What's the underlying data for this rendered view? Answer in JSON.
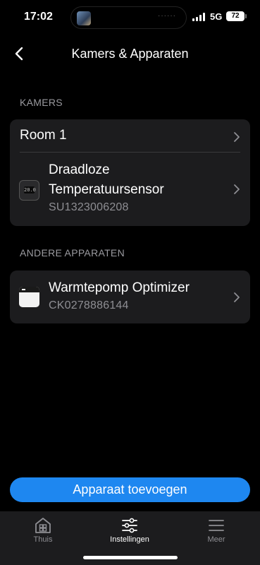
{
  "status_bar": {
    "time": "17:02",
    "network": "5G",
    "battery": "72",
    "activity_dots": "······"
  },
  "header": {
    "title": "Kamers & Apparaten",
    "back_icon": "chevron-left-icon"
  },
  "sections": {
    "rooms_label": "KAMERS",
    "other_label": "ANDERE APPARATEN"
  },
  "rooms": [
    {
      "name": "Room 1",
      "devices": [
        {
          "name": "Draadloze Temperatuursensor",
          "serial": "SU1323006208",
          "icon": "thermostat-icon",
          "display_text": "20.0"
        }
      ]
    }
  ],
  "other_devices": [
    {
      "name": "Warmtepomp Optimizer",
      "serial": "CK0278886144",
      "icon": "optimizer-device-icon"
    }
  ],
  "add_button": {
    "label": "Apparaat toevoegen",
    "color": "#1e87f0"
  },
  "tabs": [
    {
      "label": "Thuis",
      "icon": "home-icon",
      "active": false
    },
    {
      "label": "Instellingen",
      "icon": "sliders-icon",
      "active": true
    },
    {
      "label": "Meer",
      "icon": "menu-icon",
      "active": false
    }
  ]
}
